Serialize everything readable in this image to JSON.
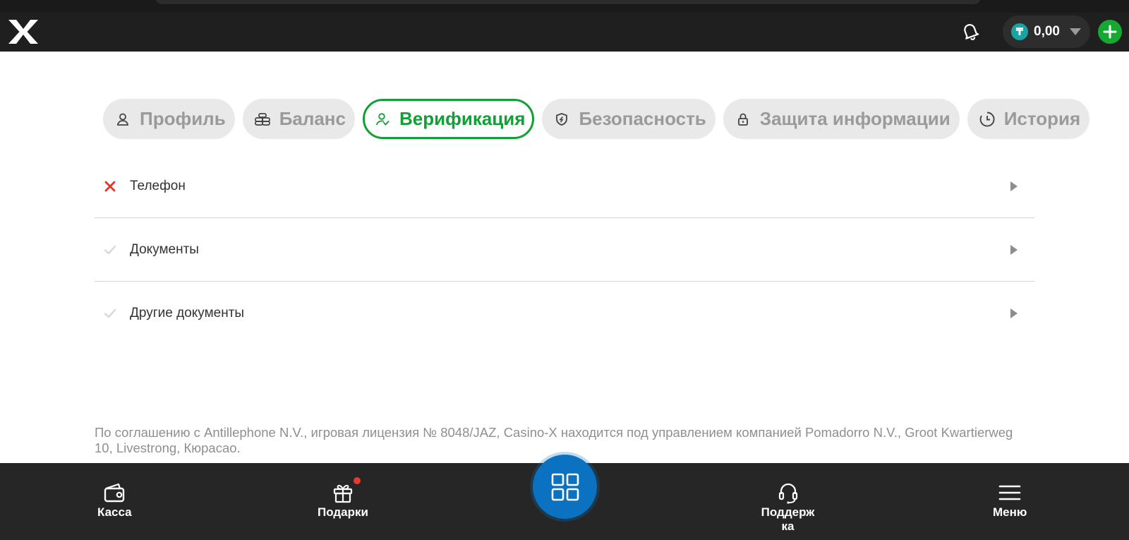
{
  "header": {
    "logo_text": "X",
    "balance": {
      "currency_symbol": "₸",
      "value": "0,00"
    }
  },
  "tabs": [
    {
      "label": "Профиль",
      "icon": "user-icon",
      "active": false
    },
    {
      "label": "Баланс",
      "icon": "coins-icon",
      "active": false
    },
    {
      "label": "Верификация",
      "icon": "user-check-icon",
      "active": true
    },
    {
      "label": "Безопасность",
      "icon": "shield-icon",
      "active": false
    },
    {
      "label": "Защита информации",
      "icon": "lock-icon",
      "active": false
    },
    {
      "label": "История",
      "icon": "clock-icon",
      "active": false
    }
  ],
  "verification": [
    {
      "label": "Телефон",
      "status": "not-verified"
    },
    {
      "label": "Документы",
      "status": "pending"
    },
    {
      "label": "Другие документы",
      "status": "pending"
    }
  ],
  "legal_text": "По соглашению с Antillephone N.V., игровая лицензия № 8048/JAZ, Casino-X находится под управлением компанией Pomadorro N.V., Groot Kwartierweg 10, Livestrong, Кюрасао.",
  "bottom_nav": {
    "cashier": "Касса",
    "gifts": "Подарки",
    "support": "Поддерж\nка",
    "menu": "Меню"
  },
  "colors": {
    "accent_green": "#12a036",
    "header_bg": "#1f1f1f",
    "nav_bg": "#262626",
    "center_blue": "#0a72c0",
    "error_red": "#e0352b"
  }
}
